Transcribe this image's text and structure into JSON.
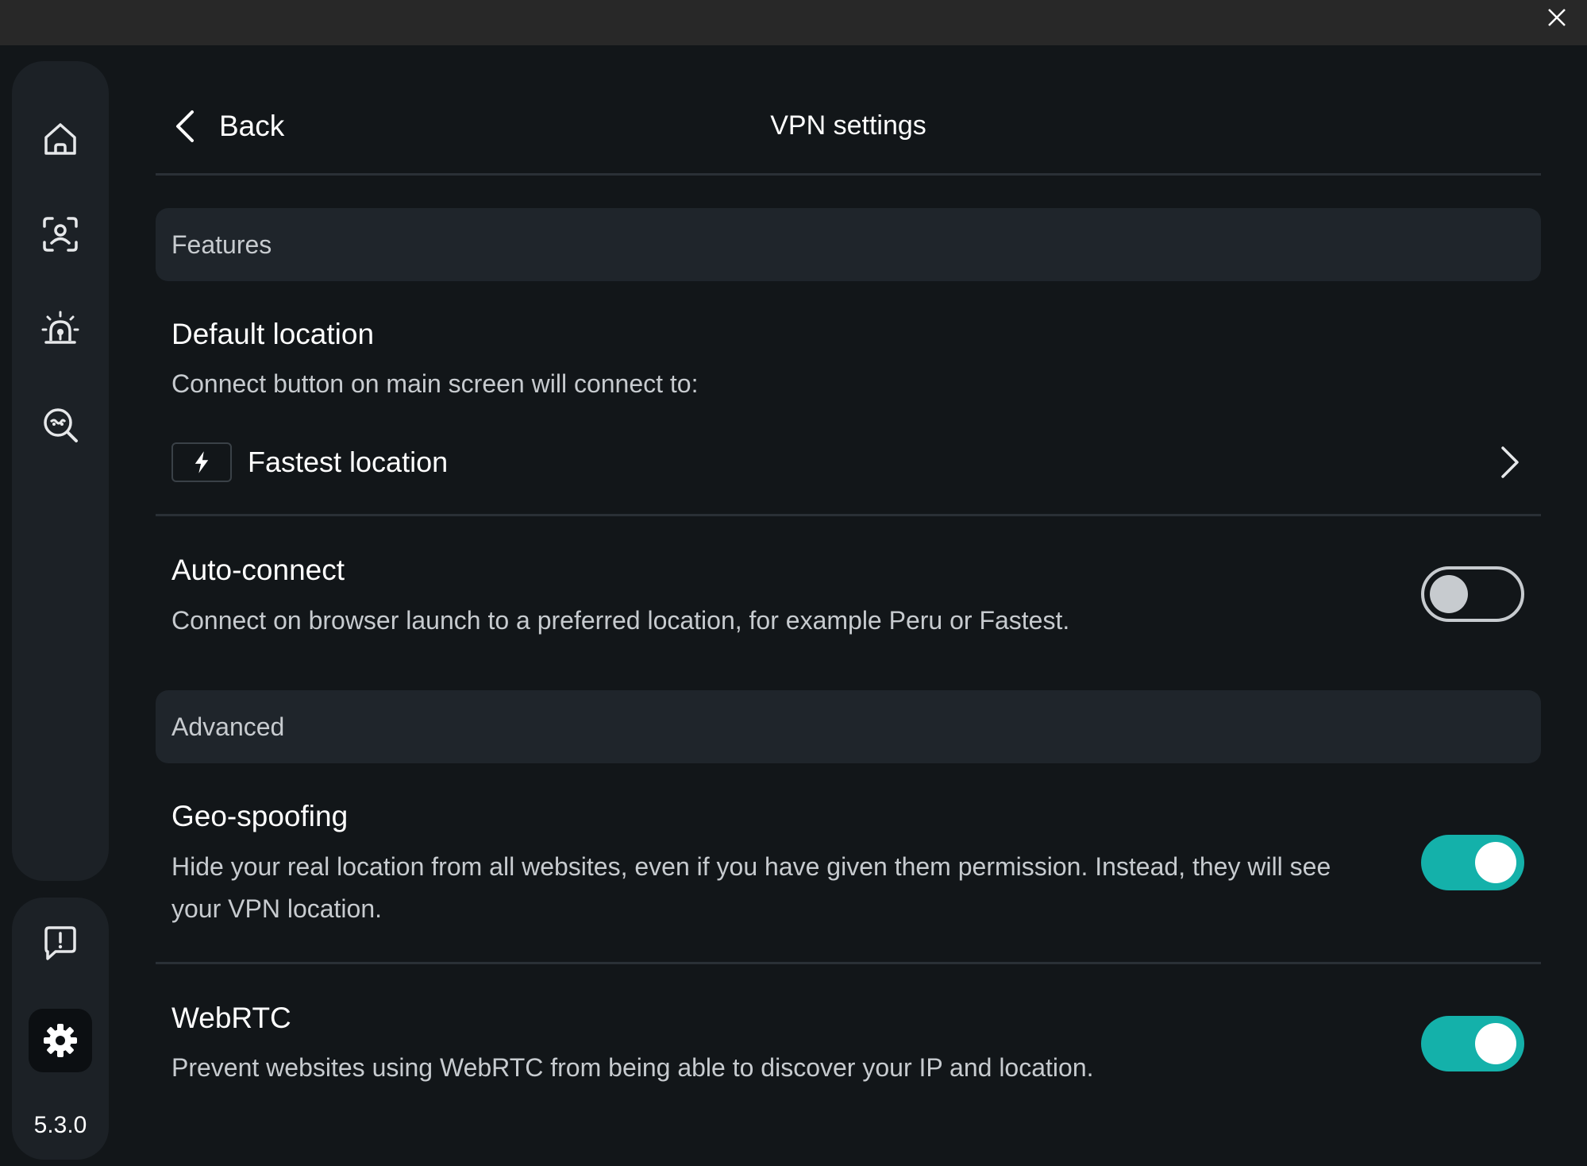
{
  "window": {
    "close_icon": "close-icon"
  },
  "sidebar": {
    "nav_items": [
      {
        "name": "home",
        "icon": "home-icon"
      },
      {
        "name": "identity",
        "icon": "face-scan-icon"
      },
      {
        "name": "alerts",
        "icon": "alarm-icon"
      },
      {
        "name": "monitor",
        "icon": "search-spy-icon"
      }
    ],
    "feedback_icon": "feedback-icon",
    "settings_icon": "gear-icon",
    "version": "5.3.0"
  },
  "header": {
    "back_label": "Back",
    "title": "VPN settings"
  },
  "sections": {
    "features": "Features",
    "advanced": "Advanced"
  },
  "default_location": {
    "title": "Default location",
    "description": "Connect button on main screen will connect to:",
    "value": "Fastest location",
    "icon": "bolt-icon"
  },
  "auto_connect": {
    "title": "Auto-connect",
    "description": "Connect on browser launch to a preferred location, for example Peru or Fastest.",
    "enabled": false
  },
  "geo_spoofing": {
    "title": "Geo-spoofing",
    "description": "Hide your real location from all websites, even if you have given them permission. Instead, they will see your VPN location.",
    "enabled": true
  },
  "webrtc": {
    "title": "WebRTC",
    "description": "Prevent websites using WebRTC from being able to discover your IP and location.",
    "enabled": true
  },
  "colors": {
    "accent": "#14b1aa",
    "background": "#121619",
    "panel": "#1c2126",
    "section_header": "#1f252b"
  }
}
